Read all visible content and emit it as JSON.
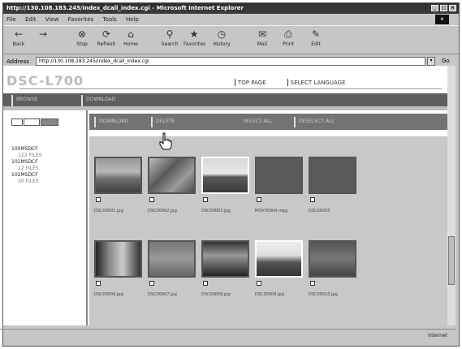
{
  "window": {
    "title": "http://130.108.183.245/index_dcall_index.cgi - Microsoft Internet Explorer"
  },
  "menu": [
    "File",
    "Edit",
    "View",
    "Favorites",
    "Tools",
    "Help"
  ],
  "toolbar": [
    {
      "icon": "back-icon",
      "label": "Back"
    },
    {
      "icon": "forward-icon",
      "label": ""
    },
    {
      "icon": "stop-icon",
      "label": "Stop"
    },
    {
      "icon": "refresh-icon",
      "label": "Refresh"
    },
    {
      "icon": "home-icon",
      "label": "Home"
    },
    {
      "icon": "search-icon",
      "label": "Search"
    },
    {
      "icon": "favorites-icon",
      "label": "Favorites"
    },
    {
      "icon": "history-icon",
      "label": "History"
    },
    {
      "icon": "mail-icon",
      "label": "Mail"
    },
    {
      "icon": "print-icon",
      "label": "Print"
    },
    {
      "icon": "edit-icon",
      "label": "Edit"
    }
  ],
  "address": {
    "label": "Address",
    "value": "http://130.108.183.245/index_dcall_index.cgi",
    "go": "Go"
  },
  "page": {
    "brand": "DSC-L700",
    "links": [
      "TOP PAGE",
      "SELECT LANGUAGE"
    ],
    "tabs": [
      "BROWSE",
      "DOWNLOAD"
    ],
    "main_tabs": [
      "DOWNLOAD",
      "DELETE",
      "SELECT ALL",
      "DESELECT ALL"
    ],
    "folders": [
      {
        "name": "100MSDCF",
        "sub": "123 FILES"
      },
      {
        "name": "101MSDCF",
        "sub": "12 FILES"
      },
      {
        "name": "102MSDCF",
        "sub": "30 FILES"
      }
    ],
    "row1_files": [
      "DSC00001.jpg",
      "DSC00002.jpg",
      "DSC00003.jpg",
      "MOV00004.mpg",
      "DSC00005"
    ],
    "row2_files": [
      "DSC00006.jpg",
      "DSC00007.jpg",
      "DSC00008.jpg",
      "DSC00009.jpg",
      "DSC00010.jpg"
    ]
  },
  "status": {
    "zone": "Internet"
  }
}
